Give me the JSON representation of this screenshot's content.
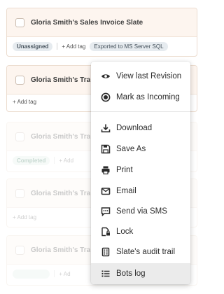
{
  "cards": [
    {
      "title": "Gloria Smith's Sales Invoice Slate",
      "status": "Unassigned",
      "add_tag": "+ Add tag",
      "export": "Exported to MS Server SQL"
    },
    {
      "title": "Gloria Smith's Tra",
      "add_tag": "+ Add tag"
    },
    {
      "title": "Gloria Smith's Tra",
      "status": "Completed",
      "add_tag": "+ Add"
    },
    {
      "title": "Gloria Smith's Tra",
      "add_tag": "+ Add tag"
    },
    {
      "title": "Gloria Smith's Tra",
      "add_tag": "+ Ad"
    }
  ],
  "menu": {
    "items": [
      {
        "label": "View last Revision",
        "icon": "eye-icon"
      },
      {
        "label": "Mark as Incoming",
        "icon": "target-circle-icon"
      },
      {
        "label": "Download",
        "icon": "download-icon"
      },
      {
        "label": "Save As",
        "icon": "floppy-disk-icon"
      },
      {
        "label": "Print",
        "icon": "printer-icon"
      },
      {
        "label": "Email",
        "icon": "envelope-icon"
      },
      {
        "label": "Send via SMS",
        "icon": "chat-bubble-icon"
      },
      {
        "label": "Lock",
        "icon": "lock-document-icon"
      },
      {
        "label": "Slate's audit trail",
        "icon": "audit-list-icon"
      },
      {
        "label": "Bots log",
        "icon": "list-icon"
      }
    ],
    "highlighted": "Bots log"
  }
}
